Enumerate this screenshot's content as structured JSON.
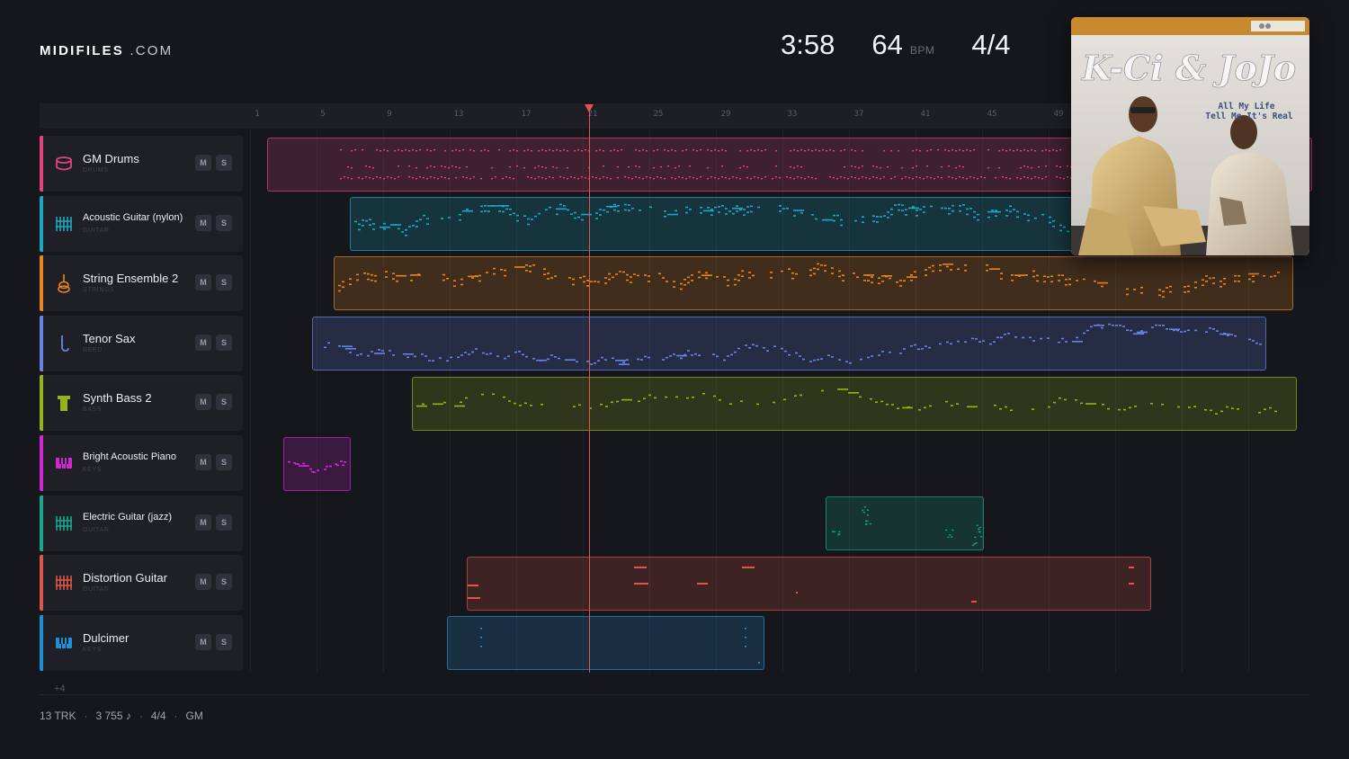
{
  "header": {
    "logo_bold": "MIDIFILES",
    "logo_light": ".COM",
    "duration": "3:58",
    "tempo": "64",
    "tempo_unit": "BPM",
    "time_signature": "4/4"
  },
  "ruler": {
    "bars": [
      "1",
      "5",
      "9",
      "13",
      "17",
      "21",
      "25",
      "29",
      "33",
      "37",
      "41",
      "45",
      "49"
    ]
  },
  "tracks": [
    {
      "name": "GM Drums",
      "category": "DRUMS",
      "icon": "drum-icon",
      "color": "#e2457c",
      "mute": "M",
      "solo": "S"
    },
    {
      "name": "Acoustic Guitar (nylon)",
      "category": "GUITAR",
      "icon": "guitar-grid-icon",
      "color": "#1ba8c4",
      "mute": "M",
      "solo": "S"
    },
    {
      "name": "String Ensemble 2",
      "category": "STRINGS",
      "icon": "violin-icon",
      "color": "#e9851d",
      "mute": "M",
      "solo": "S"
    },
    {
      "name": "Tenor Sax",
      "category": "REED",
      "icon": "saxophone-icon",
      "color": "#6a82e4",
      "mute": "M",
      "solo": "S"
    },
    {
      "name": "Synth Bass 2",
      "category": "BASS",
      "icon": "bass-icon",
      "color": "#96b41a",
      "mute": "M",
      "solo": "S"
    },
    {
      "name": "Bright Acoustic Piano",
      "category": "KEYS",
      "icon": "piano-icon",
      "color": "#d126d4",
      "mute": "M",
      "solo": "S"
    },
    {
      "name": "Electric Guitar (jazz)",
      "category": "GUITAR",
      "icon": "guitar-grid-icon",
      "color": "#17a98e",
      "mute": "M",
      "solo": "S"
    },
    {
      "name": "Distortion Guitar",
      "category": "GUITAR",
      "icon": "guitar-grid-icon",
      "color": "#e0564a",
      "mute": "M",
      "solo": "S"
    },
    {
      "name": "Dulcimer",
      "category": "KEYS",
      "icon": "piano-icon",
      "color": "#1f8fd8",
      "mute": "M",
      "solo": "S"
    }
  ],
  "more_tracks": "+4",
  "footer": {
    "tracks": "13 TRK",
    "notes": "3 755 ♪",
    "meter": "4/4",
    "standard": "GM"
  },
  "album": {
    "artist": "K-Ci & JoJo",
    "subtitle_line1": "All My Life",
    "subtitle_line2": "Tell Me It's Real"
  }
}
